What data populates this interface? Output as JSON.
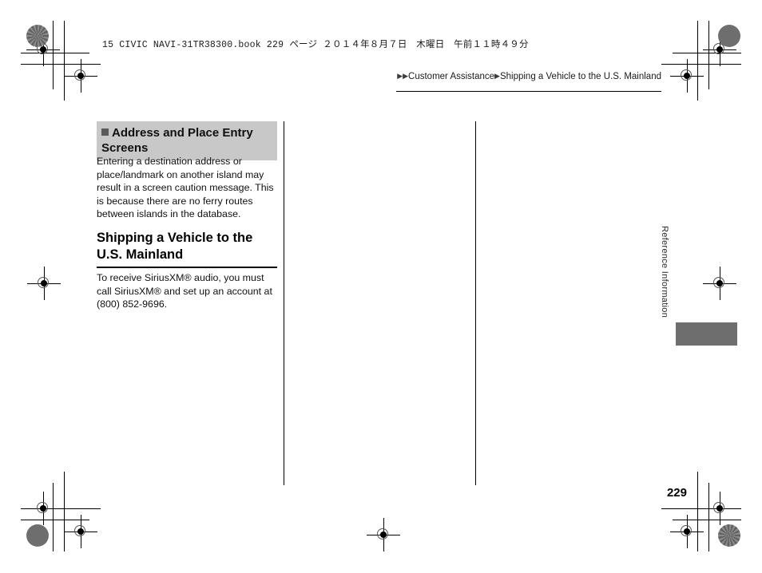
{
  "print_slug": "15 CIVIC NAVI-31TR38300.book   229 ページ    ２０１４年８月７日　木曜日　午前１１時４９分",
  "breadcrumb": {
    "arrow_glyph": "▶",
    "level1": "Customer Assistance",
    "level2": "Shipping a Vehicle to the U.S. Mainland"
  },
  "note_box": {
    "title": "Address and Place Entry Screens",
    "body": "Entering a destination address or place/landmark on another island may result in a screen caution message. This is because there are no ferry routes between islands in the database."
  },
  "section": {
    "heading": "Shipping a Vehicle to the U.S. Mainland",
    "body": "To receive SiriusXM® audio, you must call SiriusXM® and set up an account at (800) 852-9696."
  },
  "side_tab": {
    "label": "Reference Information"
  },
  "page_number": "229",
  "colors": {
    "note_box_background": "#c8c8c8",
    "note_bullet": "#5a5a5a",
    "side_tab_block": "#6e6e6e",
    "rule": "#000000",
    "text": "#111111"
  }
}
